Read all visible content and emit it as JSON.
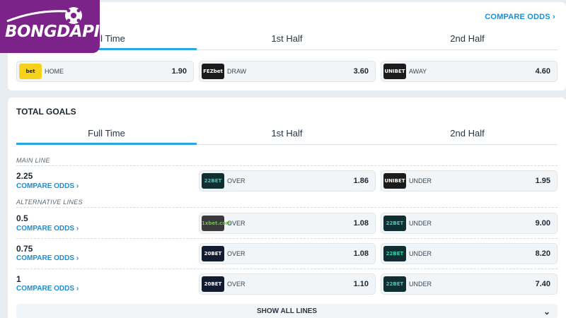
{
  "logo": {
    "text": "BONGDAPI"
  },
  "match_odds": {
    "compare_label": "COMPARE ODDS",
    "tabs": [
      "Full Time",
      "1st Half",
      "2nd Half"
    ],
    "active_tab": 0,
    "selections": [
      {
        "bookmaker": "bet",
        "label": "HOME",
        "odds": "1.90"
      },
      {
        "bookmaker": "FEZbet",
        "label": "DRAW",
        "odds": "3.60"
      },
      {
        "bookmaker": "UNIBET",
        "label": "AWAY",
        "odds": "4.60"
      }
    ]
  },
  "total_goals": {
    "title": "TOTAL GOALS",
    "tabs": [
      "Full Time",
      "1st Half",
      "2nd Half"
    ],
    "active_tab": 0,
    "main_line_label": "MAIN LINE",
    "alt_lines_label": "ALTERNATIVE LINES",
    "compare_label": "COMPARE ODDS",
    "lines": [
      {
        "value": "2.25",
        "over": {
          "bookmaker": "22BET",
          "label": "OVER",
          "odds": "1.86"
        },
        "under": {
          "bookmaker": "UNIBET",
          "label": "UNDER",
          "odds": "1.95"
        }
      },
      {
        "value": "0.5",
        "over": {
          "bookmaker": "1xbet.com",
          "label": "OVER",
          "odds": "1.08"
        },
        "under": {
          "bookmaker": "22BET",
          "label": "UNDER",
          "odds": "9.00"
        }
      },
      {
        "value": "0.75",
        "over": {
          "bookmaker": "20BET",
          "label": "OVER",
          "odds": "1.08"
        },
        "under": {
          "bookmaker": "22BET",
          "label": "UNDER",
          "odds": "8.20"
        }
      },
      {
        "value": "1",
        "over": {
          "bookmaker": "20BET",
          "label": "OVER",
          "odds": "1.10"
        },
        "under": {
          "bookmaker": "22BET",
          "label": "UNDER",
          "odds": "7.40"
        }
      }
    ],
    "show_all_label": "SHOW ALL LINES"
  }
}
